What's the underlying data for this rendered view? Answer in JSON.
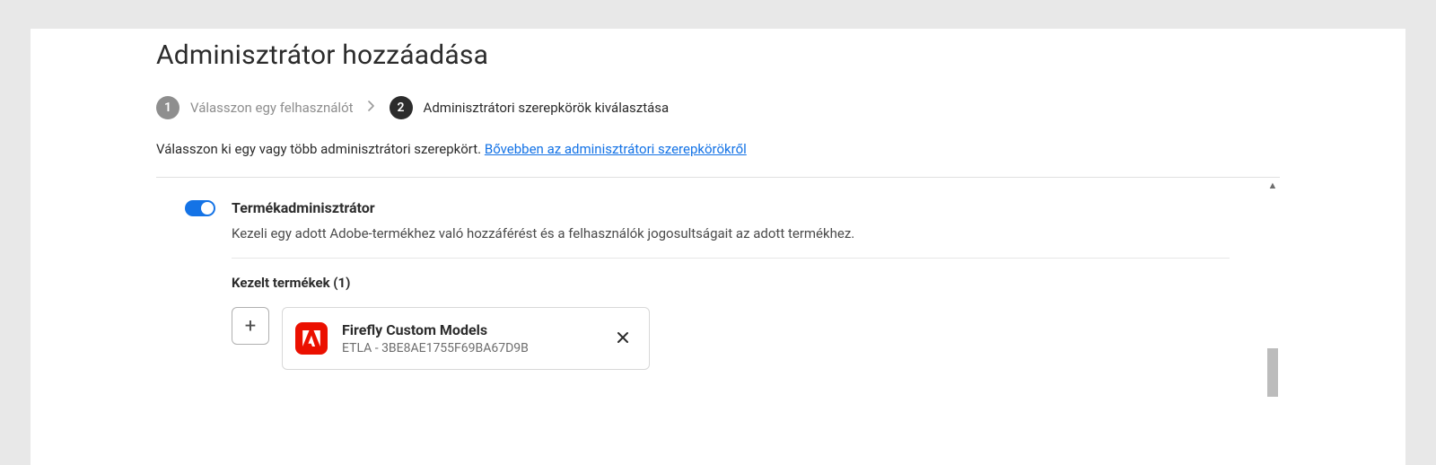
{
  "title": "Adminisztrátor hozzáadása",
  "stepper": {
    "step1": {
      "num": "1",
      "label": "Válasszon egy felhasználót"
    },
    "step2": {
      "num": "2",
      "label": "Adminisztrátori szerepkörök kiválasztása"
    }
  },
  "desc": {
    "text": "Válasszon ki egy vagy több adminisztrátori szerepkört. ",
    "link": "Bővebben az adminisztrátori szerepkörökről"
  },
  "role": {
    "title": "Termékadminisztrátor",
    "desc": "Kezeli egy adott Adobe-termékhez való hozzáférést és a felhasználók jogosultságait az adott termékhez.",
    "managed_label": "Kezelt termékek (1)"
  },
  "product": {
    "name": "Firefly Custom Models",
    "sub": "ETLA - 3BE8AE1755F69BA67D9B"
  }
}
